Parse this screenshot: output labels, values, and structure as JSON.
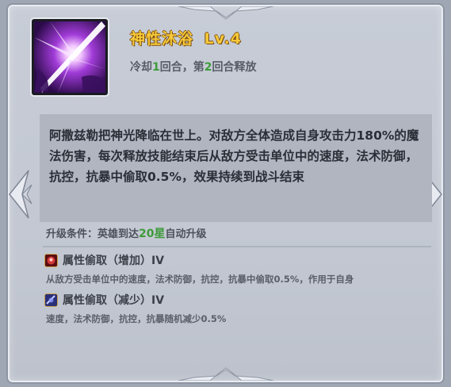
{
  "skill": {
    "name": "神性沐浴",
    "level": "Lv.4",
    "cooldown_prefix": "冷却",
    "cooldown_turns": "1",
    "cooldown_mid": "回合，第",
    "release_turn": "2",
    "cooldown_suffix": "回合释放",
    "icon": "divine-light-skill-icon",
    "description": "阿撒兹勒把神光降临在世上。对敌方全体造成自身攻击力180%的魔法伤害，每次释放技能结束后从敌方受击单位中的速度，法术防御，抗控，抗暴中偷取0.5%，效果持续到战斗结束"
  },
  "upgrade": {
    "label": "升级条件：",
    "text_before": "英雄到达",
    "stars": "20星",
    "text_after": "自动升级"
  },
  "attributes": [
    {
      "icon": "steal-increase-icon",
      "title": "属性偷取（增加）IV",
      "desc": "从敌方受击单位中的速度，法术防御，抗控，抗暴中偷取0.5%，作用于自身"
    },
    {
      "icon": "steal-decrease-icon",
      "title": "属性偷取（减少）IV",
      "desc": "速度，法术防御，抗控，抗暴随机减少0.5%"
    }
  ],
  "colors": {
    "title": "#f6c93a",
    "highlight_green": "#3d9c3a",
    "panel": "#c4c9d3",
    "desc_box": "#b0b5bf"
  }
}
